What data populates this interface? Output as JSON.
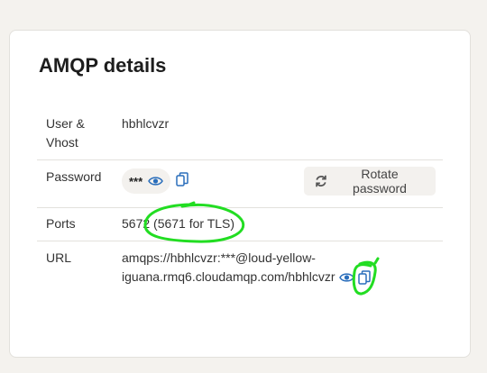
{
  "section": {
    "title": "AMQP details"
  },
  "rows": {
    "user_vhost": {
      "label_line1": "User &",
      "label_line2": "Vhost",
      "value": "hbhlcvzr"
    },
    "password": {
      "label": "Password",
      "masked": "***",
      "rotate_label": "Rotate password"
    },
    "ports": {
      "label": "Ports",
      "value": "5672 (5671 for TLS)"
    },
    "url": {
      "label": "URL",
      "line1": "amqps://hbhlcvzr:***@loud-yellow-",
      "line2": "iguana.rmq6.cloudamqp.com/hbhlcvzr"
    }
  },
  "icons": {
    "eye": "eye-icon",
    "copy": "copy-icon",
    "rotate": "refresh-icon"
  },
  "colors": {
    "accent": "#2a6ebb",
    "annotation": "#22dd22"
  }
}
